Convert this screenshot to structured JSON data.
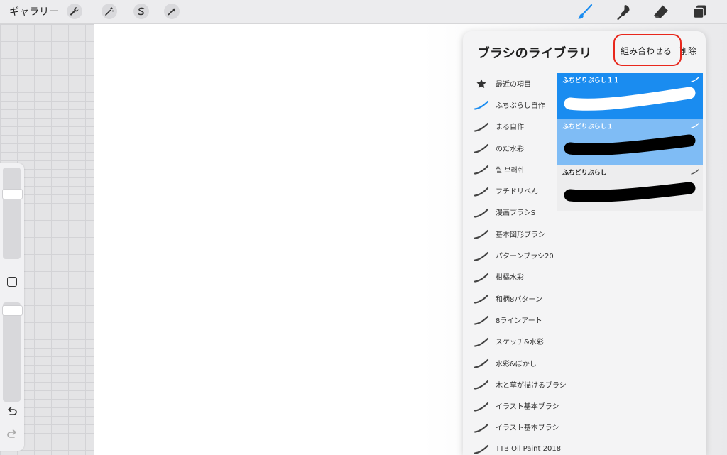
{
  "topbar": {
    "gallery_label": "ギャラリー",
    "left_tools": [
      {
        "icon": "wrench-icon"
      },
      {
        "icon": "magic-wand-icon"
      },
      {
        "icon": "selection-s-icon"
      },
      {
        "icon": "arrow-icon"
      }
    ],
    "right_tools": [
      {
        "icon": "brush-icon",
        "active": true
      },
      {
        "icon": "smudge-icon"
      },
      {
        "icon": "eraser-icon"
      },
      {
        "icon": "layers-icon"
      }
    ]
  },
  "colors": {
    "accent": "#1a8cf0",
    "selected_secondary": "#7fbcf5",
    "highlight_ring": "#e8271c"
  },
  "panel": {
    "title": "ブラシのライブラリ",
    "combine_label": "組み合わせる",
    "delete_label": "削除",
    "brush_sets": [
      {
        "label": "最近の項目",
        "icon": "star-icon"
      },
      {
        "label": "ふちぶらし自作",
        "icon": "brush-stroke-icon",
        "selected": true
      },
      {
        "label": "まる自作",
        "icon": "brush-stroke-icon"
      },
      {
        "label": "のだ水彩",
        "icon": "brush-stroke-icon"
      },
      {
        "label": "씰 브러쉬",
        "icon": "brush-stroke-icon"
      },
      {
        "label": "フチドリペん",
        "icon": "brush-stroke-icon"
      },
      {
        "label": "漫画ブラシS",
        "icon": "brush-stroke-icon"
      },
      {
        "label": "基本図形ブラシ",
        "icon": "brush-stroke-icon"
      },
      {
        "label": "パターンブラシ20",
        "icon": "brush-stroke-icon"
      },
      {
        "label": "柑橘水彩",
        "icon": "brush-stroke-icon"
      },
      {
        "label": "和柄8パターン",
        "icon": "brush-stroke-icon"
      },
      {
        "label": "8ラインアート",
        "icon": "brush-stroke-icon"
      },
      {
        "label": "スケッチ&水彩",
        "icon": "brush-stroke-icon"
      },
      {
        "label": "水彩&ぼかし",
        "icon": "brush-stroke-icon"
      },
      {
        "label": "木と草が描けるブラシ",
        "icon": "brush-stroke-icon"
      },
      {
        "label": "イラスト基本ブラシ",
        "icon": "brush-stroke-icon"
      },
      {
        "label": "イラスト基本ブラシ",
        "icon": "brush-stroke-icon"
      },
      {
        "label": "TTB Oil Paint 2018",
        "icon": "brush-stroke-icon"
      }
    ],
    "brushes": [
      {
        "name": "ふちどりぶらし１１",
        "state": "selected-primary",
        "stroke_color": "#ffffff"
      },
      {
        "name": "ふちどりぶらし１",
        "state": "selected-secondary",
        "stroke_color": "#000000"
      },
      {
        "name": "ふちどりぶらし",
        "state": "normal",
        "stroke_color": "#000000"
      }
    ]
  },
  "sidebar": {
    "undo_icon": "undo-icon",
    "redo_icon": "redo-icon"
  }
}
